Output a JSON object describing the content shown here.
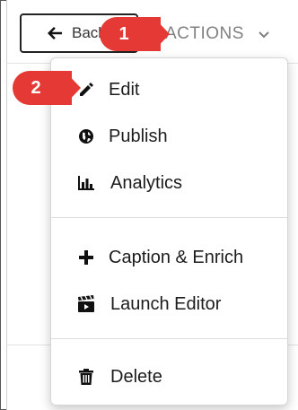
{
  "header": {
    "back_label": "Back",
    "actions_label": "ACTIONS"
  },
  "badges": {
    "step1": "1",
    "step2": "2"
  },
  "menu": {
    "items": [
      {
        "label": "Edit",
        "icon": "pencil-icon"
      },
      {
        "label": "Publish",
        "icon": "globe-icon"
      },
      {
        "label": "Analytics",
        "icon": "bar-chart-icon"
      },
      {
        "label": "Caption & Enrich",
        "icon": "plus-icon"
      },
      {
        "label": "Launch Editor",
        "icon": "clapperboard-icon"
      },
      {
        "label": "Delete",
        "icon": "trash-icon"
      }
    ]
  },
  "colors": {
    "badge": "#e53935",
    "actions_text": "#808080",
    "menu_text": "#1c1c1c"
  }
}
